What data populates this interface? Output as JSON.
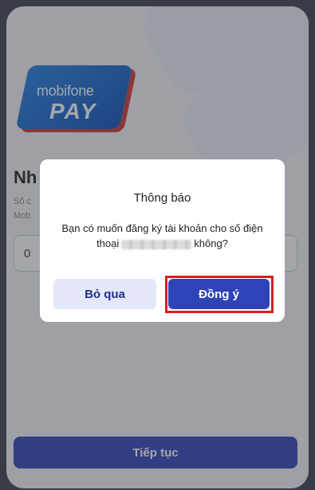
{
  "logo": {
    "line1": "mobifone",
    "line2": "PAY"
  },
  "page": {
    "title": "Nh",
    "subtitle1": "Số c",
    "subtitle2": "Mob",
    "phone_input_value": "0",
    "continue_label": "Tiếp tục"
  },
  "dialog": {
    "title": "Thông báo",
    "message_part1": "Bạn có muốn đăng ký tài khoản cho số điện thoại",
    "message_part2": "không?",
    "skip_label": "Bỏ qua",
    "agree_label": "Đồng ý"
  },
  "colors": {
    "primary": "#2f43b8",
    "secondary_bg": "#e4e8f8",
    "highlight": "#d21f1f"
  }
}
